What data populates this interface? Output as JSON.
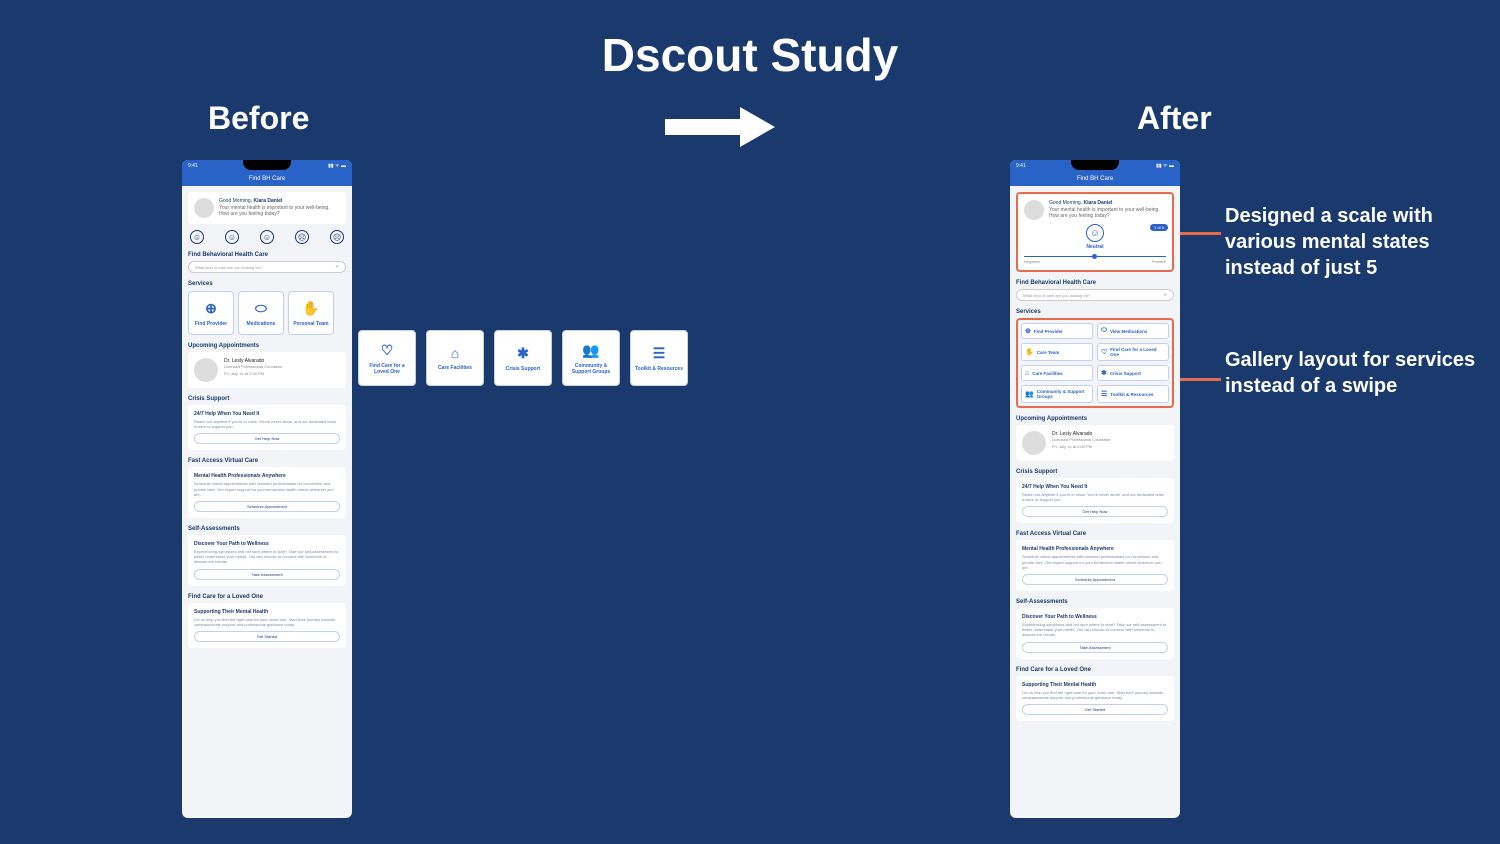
{
  "title": "Dscout Study",
  "label_before": "Before",
  "label_after": "After",
  "note1": "Designed a scale with various mental states instead of just 5",
  "note2": "Gallery layout for services instead of a swipe",
  "status_time": "9:41",
  "nav_title": "Find BH Care",
  "greeting_prefix": "Good Morning, ",
  "greeting_name": "Kiara Daniel",
  "greeting_sub": "Your mental health is important to your well-being. How are you feeling today?",
  "mood_neutral": "Neutral",
  "mood_neg": "Negative",
  "mood_pos": "Positive",
  "mood_tag": "1 of 5",
  "sect_find": "Find Behavioral Health Care",
  "search_ph": "What kind of care are you looking for?",
  "sect_services": "Services",
  "services": [
    {
      "icon": "⊕",
      "label": "Find Provider"
    },
    {
      "icon": "⬭",
      "label": "Medications"
    },
    {
      "icon": "✋",
      "label": "Personal Team"
    },
    {
      "icon": "♡",
      "label": "Find Care for a Loved One"
    },
    {
      "icon": "⌂",
      "label": "Care Facilities"
    },
    {
      "icon": "✱",
      "label": "Crisis Support"
    },
    {
      "icon": "👥",
      "label": "Community & Support Groups"
    },
    {
      "icon": "☰",
      "label": "Toolkit & Resources"
    }
  ],
  "services_after": [
    {
      "icon": "⊕",
      "label": "Find Provider"
    },
    {
      "icon": "⬭",
      "label": "View Medications"
    },
    {
      "icon": "✋",
      "label": "Care Team"
    },
    {
      "icon": "♡",
      "label": "Find Care for a Loved One"
    },
    {
      "icon": "⌂",
      "label": "Care Facilities"
    },
    {
      "icon": "✱",
      "label": "Crisis Support"
    },
    {
      "icon": "👥",
      "label": "Community & Support Groups"
    },
    {
      "icon": "☰",
      "label": "Toolkit & Resources"
    }
  ],
  "sect_appt": "Upcoming Appointments",
  "appt_name": "Dr. Lesly Alvarado",
  "appt_role": "Licensed Professional Counselor",
  "appt_time": "Fri, July 14 at 2:00 PM",
  "sect_crisis": "Crisis Support",
  "crisis_h": "24/7 Help When You Need It",
  "crisis_b": "Reach out anytime if you're in crisis. You're never alone, and our dedicated team is here to support you.",
  "crisis_btn": "Get Help Now",
  "sect_fast": "Fast Access Virtual Care",
  "fast_h": "Mental Health Professionals Anywhere",
  "fast_b": "Schedule virtual appointments with licensed professionals for convenient and private care. Get expert support for your behavioral health needs wherever you are.",
  "fast_btn": "Schedule Appointment",
  "sect_self": "Self-Assessments",
  "self_h": "Discover Your Path to Wellness",
  "self_b": "Experiencing symptoms and not sure where to start? Take our self-assessment to better understand your needs. You can choose to connect with someone to discuss the results.",
  "self_btn": "Take Assessment",
  "sect_loved": "Find Care for a Loved One",
  "loved_h": "Supporting Their Mental Health",
  "loved_b": "Let us help you find the right care for your loved one. Start their journey towards compassionate support and professional guidance today.",
  "loved_btn": "Get Started"
}
